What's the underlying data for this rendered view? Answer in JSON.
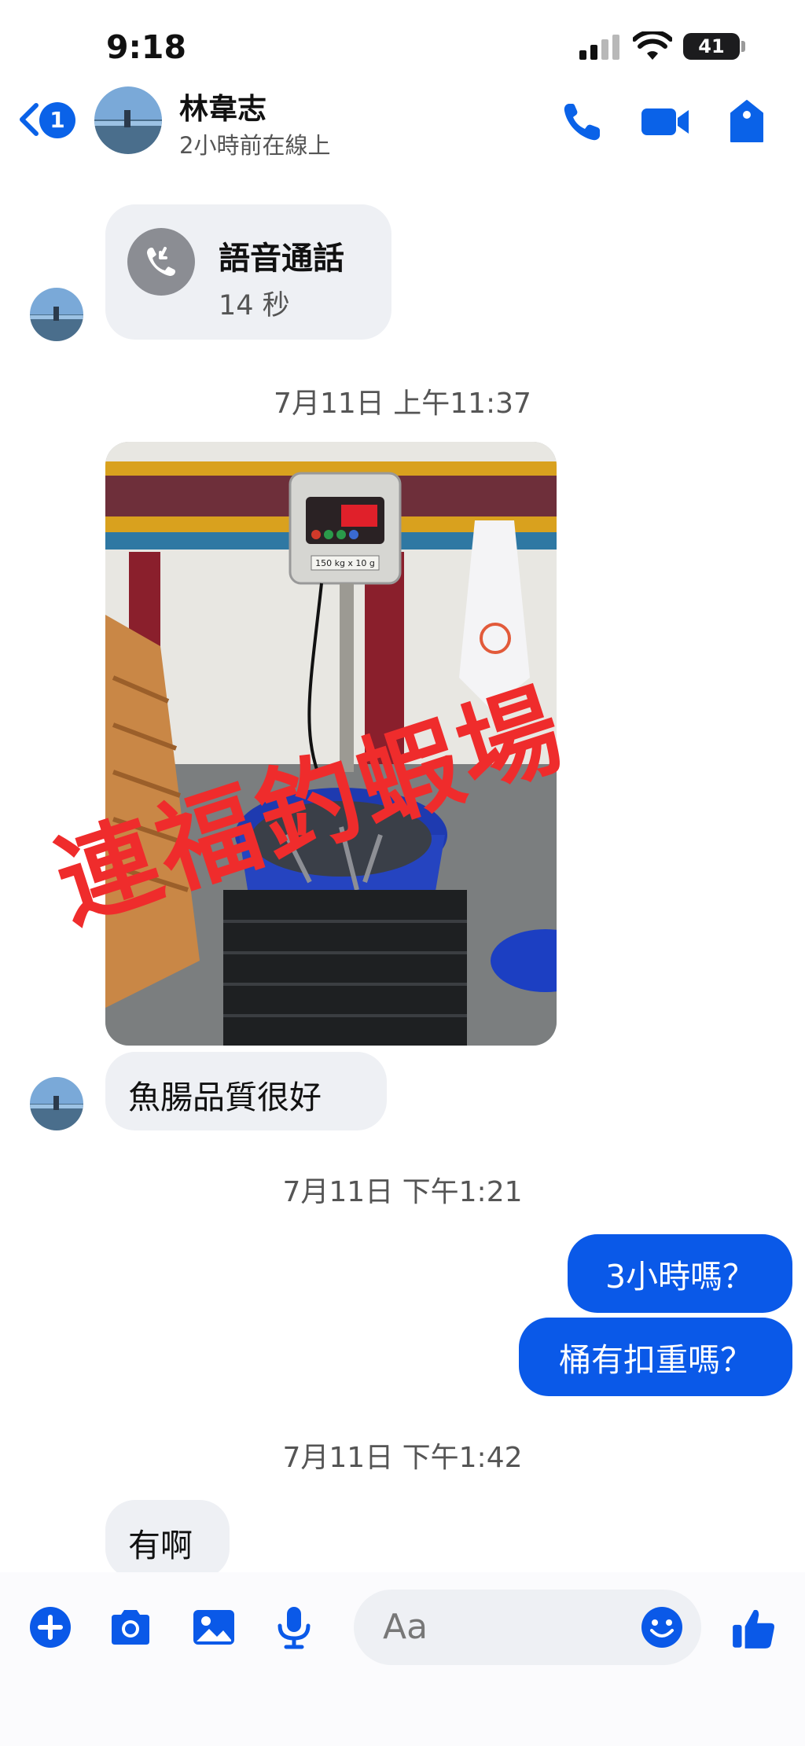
{
  "status_bar": {
    "time": "9:18",
    "battery": "41"
  },
  "header": {
    "back_badge": "1",
    "contact_name": "林韋志",
    "contact_status": "2小時前在線上",
    "icons": [
      "back-chevron-icon",
      "phone-icon",
      "video-camera-icon",
      "tag-icon"
    ]
  },
  "messages": {
    "call": {
      "title": "語音通話",
      "duration": "14 秒"
    },
    "timestamp1": "7月11日 上午11:37",
    "photo_watermark": "連福釣蝦場",
    "photo_scale_label": "150 kg x 10 g",
    "incoming1": "魚腸品質很好",
    "timestamp2": "7月11日 下午1:21",
    "outgoing1": "3小時嗎？",
    "outgoing2": "桶有扣重嗎？",
    "timestamp3": "7月11日 下午1:42",
    "incoming2": "有啊"
  },
  "composer": {
    "placeholder": "Aa",
    "tools": [
      "plus-icon",
      "camera-icon",
      "image-icon",
      "microphone-icon",
      "emoji-icon",
      "thumbs-up-icon"
    ]
  },
  "colors": {
    "accent": "#0a59e8",
    "incoming_bubble": "#eef0f4",
    "watermark": "#ef2c2c"
  }
}
